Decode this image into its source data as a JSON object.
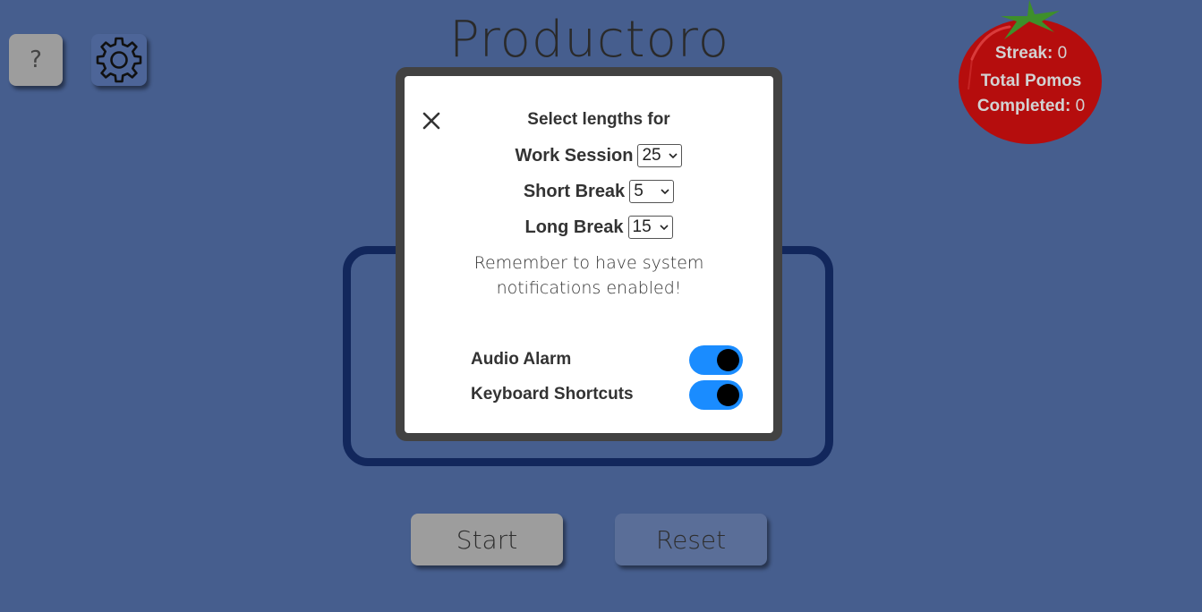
{
  "app": {
    "title": "Productoro"
  },
  "toolbar": {
    "help_label": "?"
  },
  "stats": {
    "streak_label": "Streak:",
    "streak_value": "0",
    "total_label_line1": "Total Pomos",
    "total_label_line2": "Completed:",
    "total_value": "0"
  },
  "controls": {
    "start_label": "Start",
    "reset_label": "Reset"
  },
  "settings": {
    "heading": "Select lengths for",
    "work": {
      "label": "Work Session",
      "value": "25"
    },
    "short_break": {
      "label": "Short Break",
      "value": "5"
    },
    "long_break": {
      "label": "Long Break",
      "value": "15"
    },
    "notice": "Remember to have system notifications enabled!",
    "audio_alarm": {
      "label": "Audio Alarm",
      "enabled": true
    },
    "keyboard_shortcuts": {
      "label": "Keyboard Shortcuts",
      "enabled": true
    }
  },
  "icons": {
    "help": "question-mark",
    "settings": "gear-icon",
    "close": "close-icon",
    "tomato": "tomato-icon"
  },
  "colors": {
    "background": "#465e8e",
    "timer_border": "#12275c",
    "toggle_on": "#1a8cff",
    "tomato": "#b50d0d",
    "stem": "#3e8f2a"
  }
}
